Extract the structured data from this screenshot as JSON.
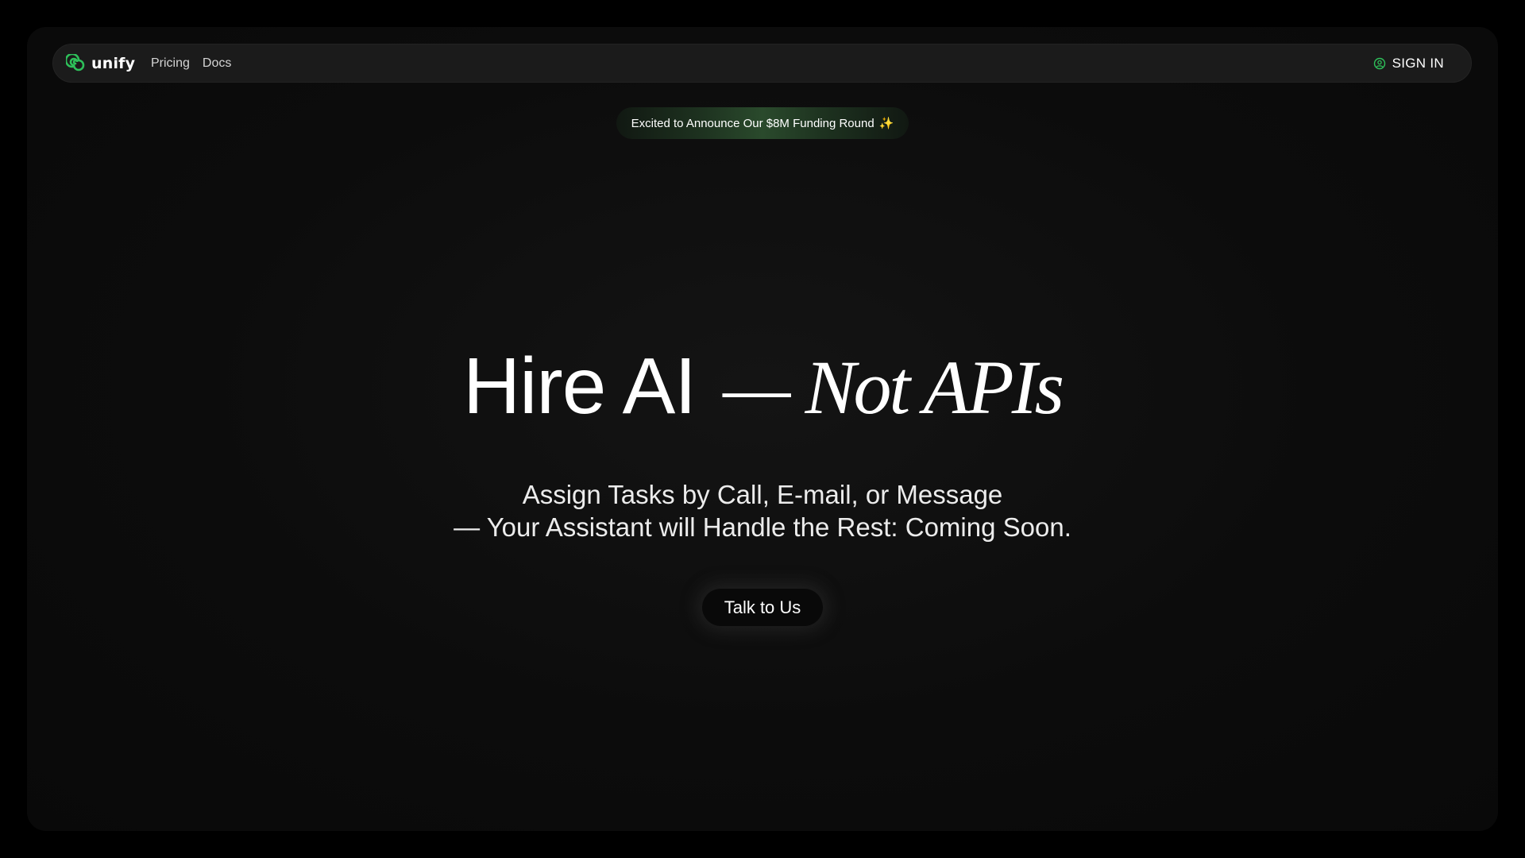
{
  "brand": {
    "name": "unify",
    "logo_icon": "swirl-logo-icon",
    "accent_color": "#2ec05a"
  },
  "nav": {
    "links": [
      "Pricing",
      "Docs"
    ],
    "signin_label": "SIGN IN",
    "signin_icon": "user-circle-icon"
  },
  "announcement": {
    "text": "Excited to Announce Our $8M Funding Round",
    "icon": "sparkle-icon",
    "icon_glyph": "✨"
  },
  "hero": {
    "title_main": "Hire AI",
    "title_italic": "— Not APIs",
    "subtitle_line1": "Assign Tasks by Call, E-mail, or Message",
    "subtitle_line2": "— Your Assistant will Handle the Rest: Coming Soon."
  },
  "cta": {
    "label": "Talk to Us"
  }
}
